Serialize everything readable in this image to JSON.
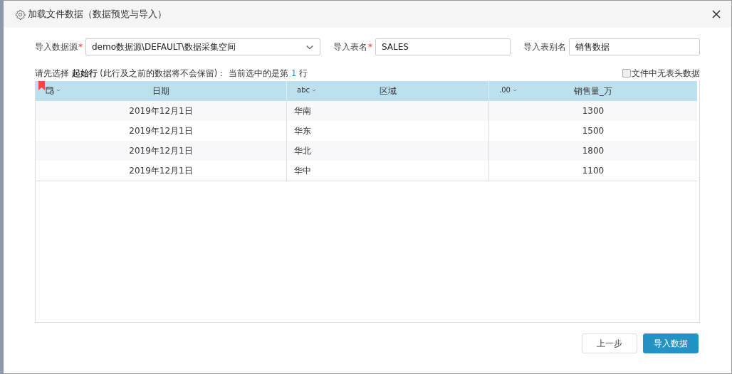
{
  "window": {
    "title": "加载文件数据（数据预览与导入）"
  },
  "form": {
    "source": {
      "label": "导入数据源",
      "required_mark": "*",
      "value": "demo数据源\\DEFAULT\\数据采集空间"
    },
    "table_name": {
      "label": "导入表名",
      "required_mark": "*",
      "value": "SALES"
    },
    "alias": {
      "label": "导入表别名",
      "value": "销售数据"
    }
  },
  "hint": {
    "text": "请先选择 **起始行** (此行及之前的数据将不会保留)：  当前选中的是第",
    "selected_row": "1",
    "suffix": "行"
  },
  "no_header": {
    "label": "文件中无表头数据",
    "checked": false
  },
  "table": {
    "columns": [
      {
        "kind": "date",
        "name": "日期"
      },
      {
        "kind": "text",
        "type_label": "abc",
        "name": "区域"
      },
      {
        "kind": "number",
        "type_label": ".00",
        "name": "销售量_万"
      }
    ],
    "rows": [
      [
        "2019年12月1日",
        "华南",
        "1300"
      ],
      [
        "2019年12月1日",
        "华东",
        "1500"
      ],
      [
        "2019年12月1日",
        "华北",
        "1800"
      ],
      [
        "2019年12月1日",
        "华中",
        "1100"
      ]
    ]
  },
  "buttons": [
    {
      "label": "上一步",
      "kind": "default"
    },
    {
      "label": "导入数据",
      "kind": "primary"
    }
  ]
}
